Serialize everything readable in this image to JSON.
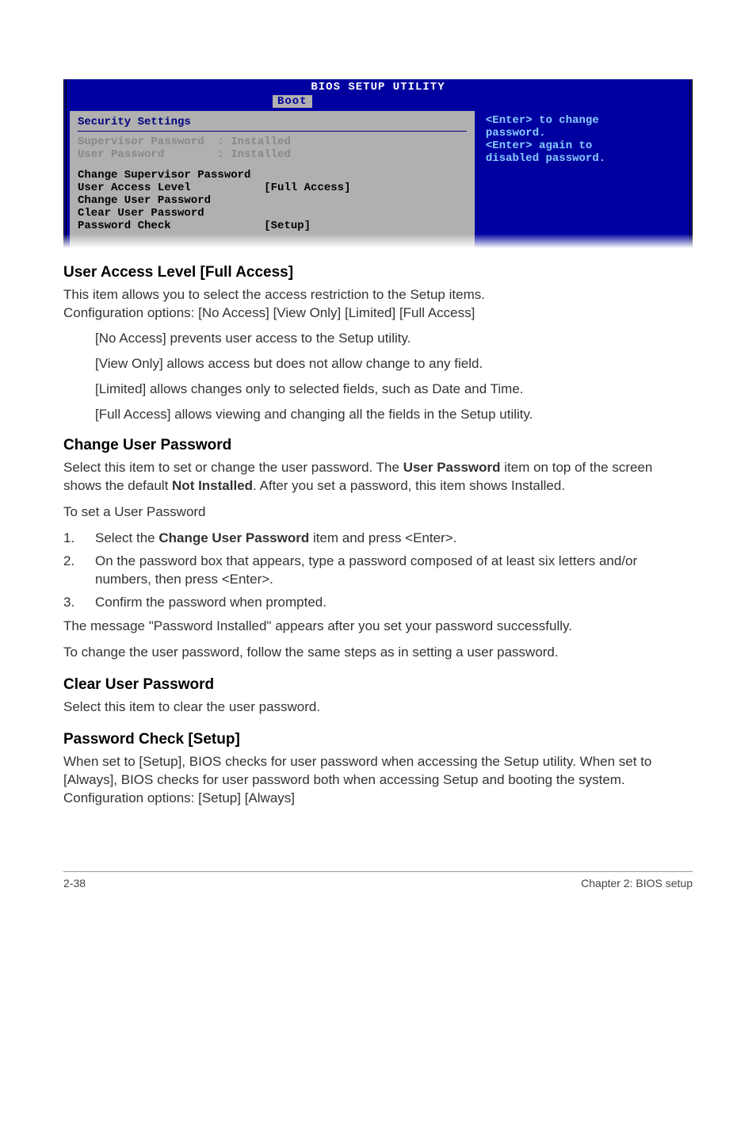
{
  "bios": {
    "title": "BIOS SETUP UTILITY",
    "tab": "Boot",
    "section_title": "Security Settings",
    "supervisor_row": "Supervisor Password  : Installed",
    "user_row": "User Password        : Installed",
    "item_change_sup": "Change Supervisor Password",
    "item_ual_label": "User Access Level",
    "item_ual_value": "[Full Access]",
    "item_change_usr": "Change User Password",
    "item_clear_usr": "Clear User Password",
    "item_pwcheck_label": "Password Check",
    "item_pwcheck_value": "[Setup]",
    "help_line1": "<Enter> to change",
    "help_line2": "password.",
    "help_line3": "<Enter> again to",
    "help_line4": "disabled password."
  },
  "sections": {
    "ual_heading": "User Access Level [Full Access]",
    "ual_p1": "This item allows you to select the access restriction to the Setup items.",
    "ual_p2": "Configuration options: [No Access] [View Only] [Limited] [Full Access]",
    "opt_noaccess": "[No Access] prevents user access to the Setup utility.",
    "opt_viewonly": "[View Only] allows access but does not allow change to any field.",
    "opt_limited": "[Limited] allows changes only to selected fields, such as Date and Time.",
    "opt_full": "[Full Access] allows viewing and changing all the fields in the Setup utility.",
    "cup_heading": "Change User Password",
    "cup_p1a": "Select this item to set or change the user password. The ",
    "cup_p1b": "User Password",
    "cup_p1c": " item on top of the screen shows the default ",
    "cup_p1d": "Not Installed",
    "cup_p1e": ". After you set a password, this item shows Installed.",
    "cup_p2": "To set a User Password",
    "step1a": "Select the ",
    "step1b": "Change User Password",
    "step1c": " item and press <Enter>.",
    "step2": "On the password box that appears, type a password composed of at least six letters and/or numbers, then press <Enter>.",
    "step3": "Confirm the password when prompted.",
    "cup_p3": "The message \"Password Installed\" appears after you set your password successfully.",
    "cup_p4": "To change the user password, follow the same steps as in setting a user password.",
    "clear_heading": "Clear User Password",
    "clear_p1": "Select this item to clear the user password.",
    "pwc_heading": "Password Check [Setup]",
    "pwc_p1": "When set to [Setup], BIOS checks for user password when accessing the Setup utility. When set to [Always], BIOS checks for user password both when accessing Setup and booting the system.",
    "pwc_p2": "Configuration options: [Setup] [Always]"
  },
  "footer": {
    "left": "2-38",
    "right": "Chapter 2: BIOS setup"
  }
}
